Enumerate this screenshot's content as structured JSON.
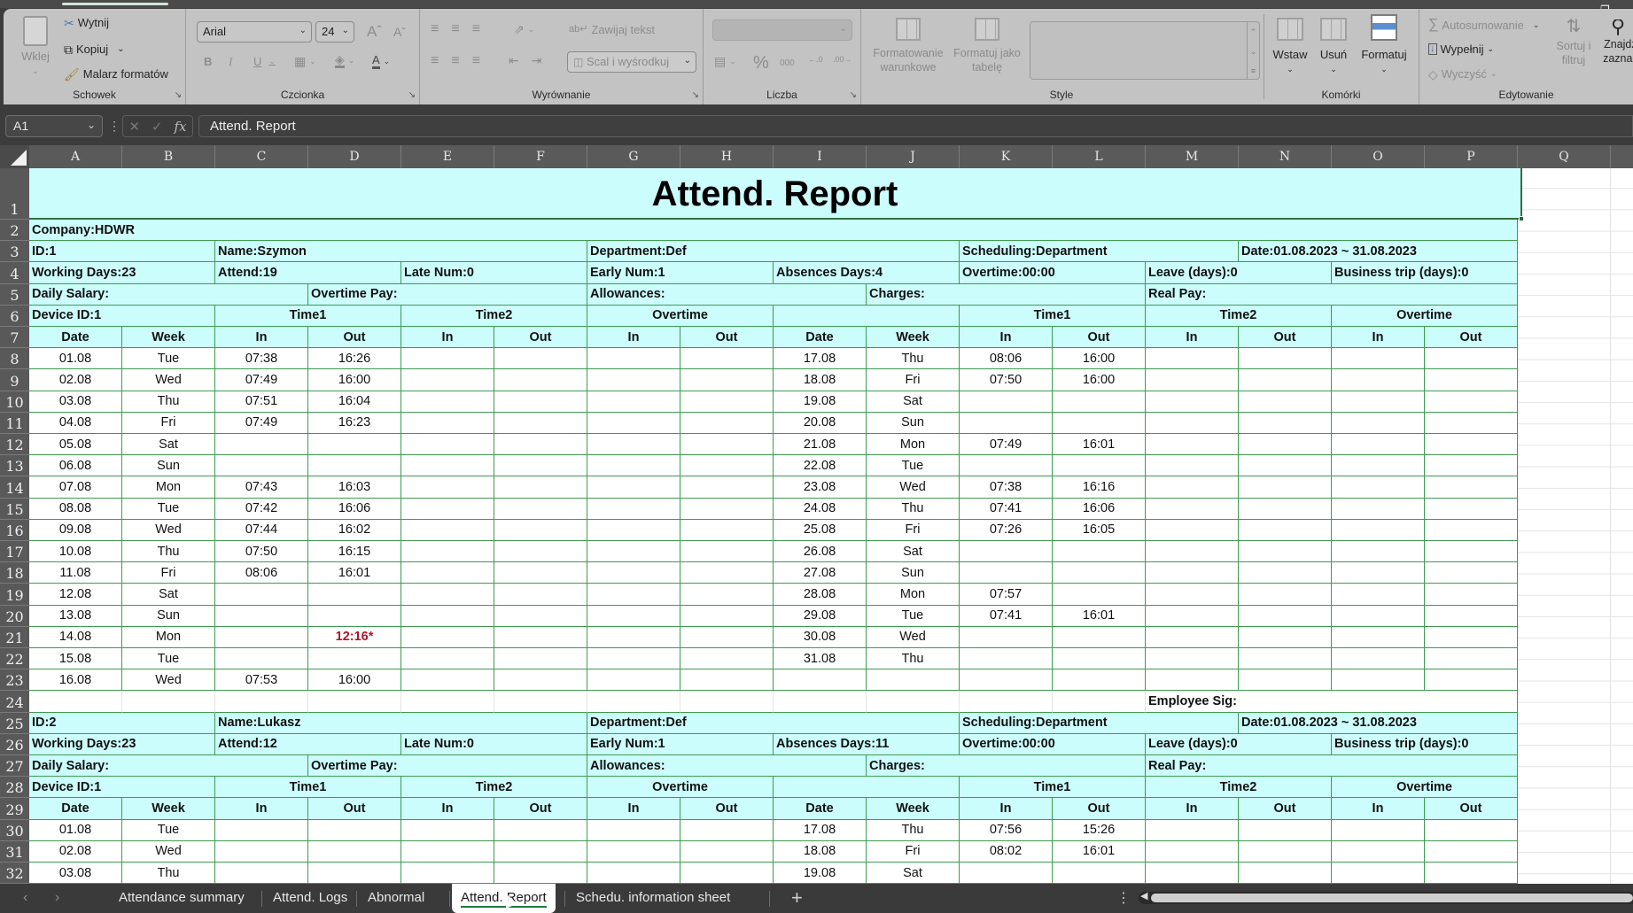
{
  "ribbon": {
    "clipboard": {
      "paste": "Wklej",
      "cut": "Wytnij",
      "copy": "Kopiuj",
      "format_painter": "Malarz formatów",
      "group_label": "Schowek"
    },
    "font": {
      "font_name": "Arial",
      "font_size": "24",
      "bold": "B",
      "italic": "I",
      "underline": "U",
      "grow": "Aˆ",
      "shrink": "Aˇ",
      "font_color": "A",
      "group_label": "Czcionka"
    },
    "alignment": {
      "wrap_text": "Zawijaj tekst",
      "merge_center": "Scal i wyśrodkuj",
      "group_label": "Wyrównanie"
    },
    "number": {
      "format_value": "",
      "percent": "%",
      "thousands": "000",
      "inc_decimal": "←.0\n.00",
      "dec_decimal": ".00\n→.0",
      "group_label": "Liczba"
    },
    "styles": {
      "conditional_formatting": "Formatowanie warunkowe",
      "format_as_table": "Formatuj jako tabelę",
      "group_label": "Style"
    },
    "cells": {
      "insert": "Wstaw",
      "delete": "Usuń",
      "format": "Formatuj",
      "group_label": "Komórki"
    },
    "editing": {
      "autosum": "Autosumowanie",
      "fill": "Wypełnij",
      "clear": "Wyczyść",
      "sort_filter": "Sortuj i filtruj",
      "find_select": "Znajdź i zaznacz",
      "group_label": "Edytowanie"
    }
  },
  "formula_bar": {
    "name_box": "A1",
    "formula": "Attend. Report",
    "fx": "fx"
  },
  "columns": [
    "A",
    "B",
    "C",
    "D",
    "E",
    "F",
    "G",
    "H",
    "I",
    "J",
    "K",
    "L",
    "M",
    "N",
    "O",
    "P",
    "Q"
  ],
  "rows": [
    "1",
    "2",
    "3",
    "4",
    "5",
    "6",
    "7",
    "8",
    "9",
    "10",
    "11",
    "12",
    "13",
    "14",
    "15",
    "16",
    "17",
    "18",
    "19",
    "20",
    "21",
    "22",
    "23",
    "24",
    "25",
    "26",
    "27",
    "28",
    "29",
    "30",
    "31",
    "32"
  ],
  "report": {
    "title": "Attend. Report",
    "company": "Company:HDWR",
    "employees": [
      {
        "id": "ID:1",
        "name": "Name:Szymon",
        "department": "Department:Def",
        "scheduling": "Scheduling:Department",
        "date_range": "Date:01.08.2023 ~ 31.08.2023",
        "working_days": "Working Days:23",
        "attend": "Attend:19",
        "late_num": "Late Num:0",
        "early_num": "Early Num:1",
        "absences_days": "Absences Days:4",
        "overtime": "Overtime:00:00",
        "leave_days": "Leave (days):0",
        "business_trip": "Business trip (days):0",
        "daily_salary": "Daily Salary:",
        "overtime_pay": "Overtime Pay:",
        "allowances": "Allowances:",
        "charges": "Charges:",
        "real_pay": "Real Pay:",
        "device_id": "Device ID:1",
        "left_rows": [
          {
            "date": "01.08",
            "week": "Tue",
            "t1_in": "07:38",
            "t1_out": "16:26"
          },
          {
            "date": "02.08",
            "week": "Wed",
            "t1_in": "07:49",
            "t1_out": "16:00"
          },
          {
            "date": "03.08",
            "week": "Thu",
            "t1_in": "07:51",
            "t1_out": "16:04"
          },
          {
            "date": "04.08",
            "week": "Fri",
            "t1_in": "07:49",
            "t1_out": "16:23"
          },
          {
            "date": "05.08",
            "week": "Sat",
            "t1_in": "",
            "t1_out": ""
          },
          {
            "date": "06.08",
            "week": "Sun",
            "t1_in": "",
            "t1_out": ""
          },
          {
            "date": "07.08",
            "week": "Mon",
            "t1_in": "07:43",
            "t1_out": "16:03"
          },
          {
            "date": "08.08",
            "week": "Tue",
            "t1_in": "07:42",
            "t1_out": "16:06"
          },
          {
            "date": "09.08",
            "week": "Wed",
            "t1_in": "07:44",
            "t1_out": "16:02"
          },
          {
            "date": "10.08",
            "week": "Thu",
            "t1_in": "07:50",
            "t1_out": "16:15"
          },
          {
            "date": "11.08",
            "week": "Fri",
            "t1_in": "08:06",
            "t1_out": "16:01"
          },
          {
            "date": "12.08",
            "week": "Sat",
            "t1_in": "",
            "t1_out": ""
          },
          {
            "date": "13.08",
            "week": "Sun",
            "t1_in": "",
            "t1_out": ""
          },
          {
            "date": "14.08",
            "week": "Mon",
            "t1_in": "",
            "t1_out": "12:16*",
            "flag": "abnormal"
          },
          {
            "date": "15.08",
            "week": "Tue",
            "t1_in": "",
            "t1_out": ""
          },
          {
            "date": "16.08",
            "week": "Wed",
            "t1_in": "07:53",
            "t1_out": "16:00"
          }
        ],
        "right_rows": [
          {
            "date": "17.08",
            "week": "Thu",
            "t1_in": "08:06",
            "t1_out": "16:00"
          },
          {
            "date": "18.08",
            "week": "Fri",
            "t1_in": "07:50",
            "t1_out": "16:00"
          },
          {
            "date": "19.08",
            "week": "Sat",
            "t1_in": "",
            "t1_out": ""
          },
          {
            "date": "20.08",
            "week": "Sun",
            "t1_in": "",
            "t1_out": ""
          },
          {
            "date": "21.08",
            "week": "Mon",
            "t1_in": "07:49",
            "t1_out": "16:01"
          },
          {
            "date": "22.08",
            "week": "Tue",
            "t1_in": "",
            "t1_out": ""
          },
          {
            "date": "23.08",
            "week": "Wed",
            "t1_in": "07:38",
            "t1_out": "16:16"
          },
          {
            "date": "24.08",
            "week": "Thu",
            "t1_in": "07:41",
            "t1_out": "16:06"
          },
          {
            "date": "25.08",
            "week": "Fri",
            "t1_in": "07:26",
            "t1_out": "16:05"
          },
          {
            "date": "26.08",
            "week": "Sat",
            "t1_in": "",
            "t1_out": ""
          },
          {
            "date": "27.08",
            "week": "Sun",
            "t1_in": "",
            "t1_out": ""
          },
          {
            "date": "28.08",
            "week": "Mon",
            "t1_in": "07:57",
            "t1_out": ""
          },
          {
            "date": "29.08",
            "week": "Tue",
            "t1_in": "07:41",
            "t1_out": "16:01"
          },
          {
            "date": "30.08",
            "week": "Wed",
            "t1_in": "",
            "t1_out": ""
          },
          {
            "date": "31.08",
            "week": "Thu",
            "t1_in": "",
            "t1_out": ""
          },
          {
            "date": "",
            "week": "",
            "t1_in": "",
            "t1_out": ""
          }
        ],
        "employee_sig": "Employee Sig:"
      },
      {
        "id": "ID:2",
        "name": "Name:Lukasz",
        "department": "Department:Def",
        "scheduling": "Scheduling:Department",
        "date_range": "Date:01.08.2023 ~ 31.08.2023",
        "working_days": "Working Days:23",
        "attend": "Attend:12",
        "late_num": "Late Num:0",
        "early_num": "Early Num:1",
        "absences_days": "Absences Days:11",
        "overtime": "Overtime:00:00",
        "leave_days": "Leave (days):0",
        "business_trip": "Business trip (days):0",
        "daily_salary": "Daily Salary:",
        "overtime_pay": "Overtime Pay:",
        "allowances": "Allowances:",
        "charges": "Charges:",
        "real_pay": "Real Pay:",
        "device_id": "Device ID:1",
        "left_rows": [
          {
            "date": "01.08",
            "week": "Tue",
            "t1_in": "",
            "t1_out": ""
          },
          {
            "date": "02.08",
            "week": "Wed",
            "t1_in": "",
            "t1_out": ""
          },
          {
            "date": "03.08",
            "week": "Thu",
            "t1_in": "",
            "t1_out": ""
          }
        ],
        "right_rows": [
          {
            "date": "17.08",
            "week": "Thu",
            "t1_in": "07:56",
            "t1_out": "15:26"
          },
          {
            "date": "18.08",
            "week": "Fri",
            "t1_in": "08:02",
            "t1_out": "16:01"
          },
          {
            "date": "19.08",
            "week": "Sat",
            "t1_in": "",
            "t1_out": ""
          }
        ]
      }
    ],
    "headers": {
      "time1": "Time1",
      "time2": "Time2",
      "overtime": "Overtime",
      "date": "Date",
      "week": "Week",
      "in": "In",
      "out": "Out"
    }
  },
  "sheet_tabs": {
    "tabs": [
      "Attendance summary",
      "Attend. Logs",
      "Abnormal",
      "Attend. Report",
      "Schedu. information sheet"
    ],
    "active": "Attend. Report",
    "add": "+",
    "prev": "‹",
    "next": "›",
    "more": "⋮"
  },
  "colors": {
    "header_fill": "#ccfdfd",
    "border": "#3f9a51",
    "abnormal_text": "#b3122b"
  }
}
